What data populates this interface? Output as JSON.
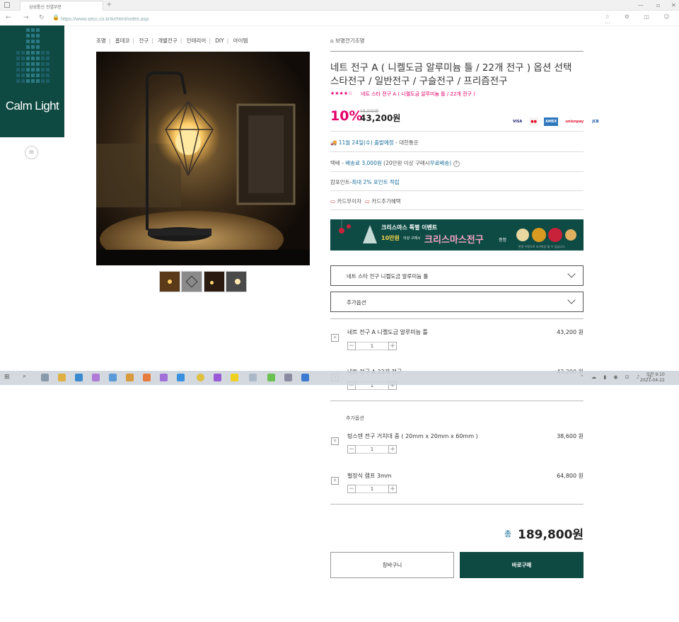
{
  "browser": {
    "tab_title": "삼성통신 진열부분",
    "address": "https://www.secc.co.kr/kr/html/index.asp"
  },
  "logo": {
    "text": "Calm Light"
  },
  "category_nav": [
    "조명",
    "홈데코",
    "전구",
    "개별전구",
    "인테리어",
    "DIY",
    "아이템"
  ],
  "brand": "보명전기조명",
  "product": {
    "title": "네트 전구 A ( 니켈도금 알루미늄 틀 / 22개 전구 ) 옵션 선택 스타전구 / 일반전구 / 구슬전구 / 프리즘전구",
    "stars": "★★★★☆",
    "sub_link": "네트 스타 전구 A ( 니켈도금 알루미늄 틀 / 22개 전구 )",
    "discount": "10%",
    "original_price": "48,000원",
    "price": "43,200원"
  },
  "payment_cards": [
    "VISA",
    "MC",
    "AMEX",
    "unionpay",
    "JCB"
  ],
  "shipping": {
    "date": "11월 24일(수) 출발예정",
    "carrier": "- 대한통운"
  },
  "delivery": {
    "prefix": "택배 -",
    "fee": "배송료 3,000원",
    "cond": "(20만원 이상 구매시",
    "free": "무료배송)",
    "help": "?"
  },
  "points": {
    "prefix": "캄포인트-",
    "text": "최대 2% 포인트 적립"
  },
  "card_links": {
    "free_install": "카드무이자",
    "card_benefit": "카드추가혜택"
  },
  "banner": {
    "line1": "크리스마스 특별 이벤트",
    "amount": "10만원",
    "cond": "이상 구매시",
    "big": "크리스마스전구",
    "gift": "증정",
    "small": "한정 수량으로 조기마감 될 수 있습니다."
  },
  "selects": {
    "option": "네트 스타 전구 니켈도금 알루미늄 틀",
    "extra": "추가옵션"
  },
  "items": [
    {
      "name": "네트 전구 A 니켈도금 알루미늄 틀",
      "qty": "1",
      "price": "43,200 원"
    },
    {
      "name": "네트 전구 A 22개 전구",
      "qty": "1",
      "price": "43,200 원"
    }
  ],
  "addon_label": "추가옵션",
  "addons": [
    {
      "name": "텅스텐 전구 거치대 중 ( 20mm x 20mm x 60mm )",
      "qty": "1",
      "price": "38,600 원"
    },
    {
      "name": "벌장식 램프 3mm",
      "qty": "1",
      "price": "64,800 원"
    }
  ],
  "total": {
    "label": "총",
    "value": "189,800원"
  },
  "buttons": {
    "cart": "장바구니",
    "buy": "바로구매"
  },
  "taskbar": {
    "time": "오전 9:10",
    "date": "2021-04-22"
  }
}
